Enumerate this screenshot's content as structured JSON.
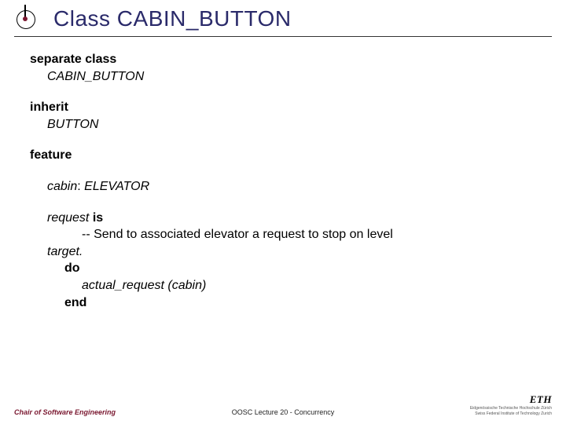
{
  "title": "Class CABIN_BUTTON",
  "code": {
    "kw_separate_class": "separate class",
    "class_name": "CABIN_BUTTON",
    "kw_inherit": "inherit",
    "parent": "BUTTON",
    "kw_feature": "feature",
    "attr_name": "cabin",
    "attr_colon": ": ",
    "attr_type": "ELEVATOR",
    "routine_name": "request",
    "kw_is": " is",
    "comment": "-- Send to associated elevator a request to stop on level",
    "target_dot": "target.",
    "kw_do": "do",
    "call": "actual_request (cabin)",
    "kw_end": "end"
  },
  "footer": {
    "left": "Chair of Software Engineering",
    "center": "OOSC  Lecture 20 - Concurrency",
    "brand": "ETH",
    "sub1": "Eidgenössische Technische Hochschule Zürich",
    "sub2": "Swiss Federal Institute of Technology Zurich"
  }
}
